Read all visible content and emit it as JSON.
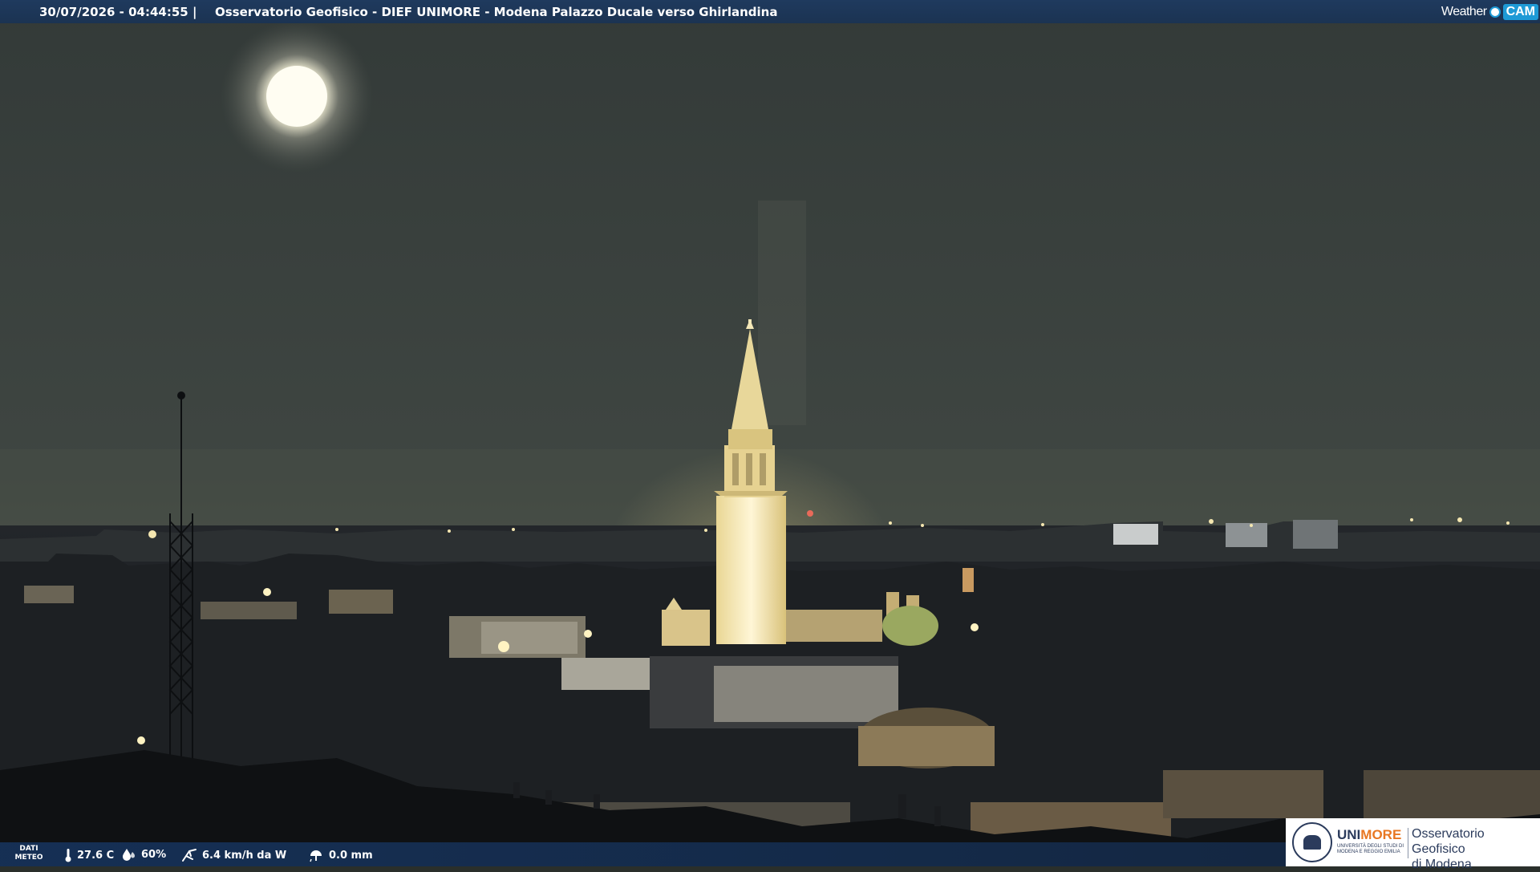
{
  "overlay": {
    "timestamp": "30/07/2026 - 04:44:55",
    "separator": "|",
    "title": "Osservatorio Geofisico - DIEF UNIMORE - Modena Palazzo Ducale verso Ghirlandina"
  },
  "brand": {
    "weather_text": "Weather",
    "cam_text": "CAM",
    "accent": "#1e9ad6"
  },
  "weather": {
    "label_line1": "DATI",
    "label_line2": "METEO",
    "temperature": "27.6 C",
    "humidity": "60%",
    "wind": "6.4 km/h da W",
    "rain": "0.0 mm",
    "icons": [
      "thermometer-icon",
      "humidity-drop-icon",
      "wind-icon",
      "rain-gauge-icon"
    ]
  },
  "logo": {
    "uni": "UNI",
    "more": "MORE",
    "subtitle": "UNIVERSITÀ DEGLI STUDI DI MODENA E REGGIO EMILIA",
    "observatory_line1": "Osservatorio Geofisico",
    "observatory_line2": "di Modena",
    "colors": {
      "navy": "#2b3b5c",
      "orange": "#e87722"
    }
  },
  "scene": {
    "sky_color": "#3c4340",
    "moon_color": "#fffbe8",
    "tower_light": "#fff1c4"
  }
}
